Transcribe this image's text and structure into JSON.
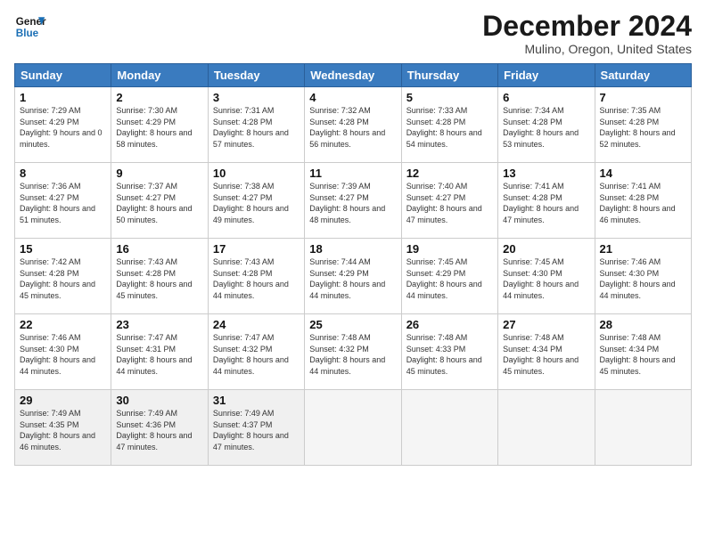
{
  "header": {
    "logo_text_general": "General",
    "logo_text_blue": "Blue",
    "month_title": "December 2024",
    "location": "Mulino, Oregon, United States"
  },
  "days_of_week": [
    "Sunday",
    "Monday",
    "Tuesday",
    "Wednesday",
    "Thursday",
    "Friday",
    "Saturday"
  ],
  "weeks": [
    [
      {
        "day": "1",
        "sunrise": "7:29 AM",
        "sunset": "4:29 PM",
        "daylight": "9 hours and 0 minutes."
      },
      {
        "day": "2",
        "sunrise": "7:30 AM",
        "sunset": "4:29 PM",
        "daylight": "8 hours and 58 minutes."
      },
      {
        "day": "3",
        "sunrise": "7:31 AM",
        "sunset": "4:28 PM",
        "daylight": "8 hours and 57 minutes."
      },
      {
        "day": "4",
        "sunrise": "7:32 AM",
        "sunset": "4:28 PM",
        "daylight": "8 hours and 56 minutes."
      },
      {
        "day": "5",
        "sunrise": "7:33 AM",
        "sunset": "4:28 PM",
        "daylight": "8 hours and 54 minutes."
      },
      {
        "day": "6",
        "sunrise": "7:34 AM",
        "sunset": "4:28 PM",
        "daylight": "8 hours and 53 minutes."
      },
      {
        "day": "7",
        "sunrise": "7:35 AM",
        "sunset": "4:28 PM",
        "daylight": "8 hours and 52 minutes."
      }
    ],
    [
      {
        "day": "8",
        "sunrise": "7:36 AM",
        "sunset": "4:27 PM",
        "daylight": "8 hours and 51 minutes."
      },
      {
        "day": "9",
        "sunrise": "7:37 AM",
        "sunset": "4:27 PM",
        "daylight": "8 hours and 50 minutes."
      },
      {
        "day": "10",
        "sunrise": "7:38 AM",
        "sunset": "4:27 PM",
        "daylight": "8 hours and 49 minutes."
      },
      {
        "day": "11",
        "sunrise": "7:39 AM",
        "sunset": "4:27 PM",
        "daylight": "8 hours and 48 minutes."
      },
      {
        "day": "12",
        "sunrise": "7:40 AM",
        "sunset": "4:27 PM",
        "daylight": "8 hours and 47 minutes."
      },
      {
        "day": "13",
        "sunrise": "7:41 AM",
        "sunset": "4:28 PM",
        "daylight": "8 hours and 47 minutes."
      },
      {
        "day": "14",
        "sunrise": "7:41 AM",
        "sunset": "4:28 PM",
        "daylight": "8 hours and 46 minutes."
      }
    ],
    [
      {
        "day": "15",
        "sunrise": "7:42 AM",
        "sunset": "4:28 PM",
        "daylight": "8 hours and 45 minutes."
      },
      {
        "day": "16",
        "sunrise": "7:43 AM",
        "sunset": "4:28 PM",
        "daylight": "8 hours and 45 minutes."
      },
      {
        "day": "17",
        "sunrise": "7:43 AM",
        "sunset": "4:28 PM",
        "daylight": "8 hours and 44 minutes."
      },
      {
        "day": "18",
        "sunrise": "7:44 AM",
        "sunset": "4:29 PM",
        "daylight": "8 hours and 44 minutes."
      },
      {
        "day": "19",
        "sunrise": "7:45 AM",
        "sunset": "4:29 PM",
        "daylight": "8 hours and 44 minutes."
      },
      {
        "day": "20",
        "sunrise": "7:45 AM",
        "sunset": "4:30 PM",
        "daylight": "8 hours and 44 minutes."
      },
      {
        "day": "21",
        "sunrise": "7:46 AM",
        "sunset": "4:30 PM",
        "daylight": "8 hours and 44 minutes."
      }
    ],
    [
      {
        "day": "22",
        "sunrise": "7:46 AM",
        "sunset": "4:30 PM",
        "daylight": "8 hours and 44 minutes."
      },
      {
        "day": "23",
        "sunrise": "7:47 AM",
        "sunset": "4:31 PM",
        "daylight": "8 hours and 44 minutes."
      },
      {
        "day": "24",
        "sunrise": "7:47 AM",
        "sunset": "4:32 PM",
        "daylight": "8 hours and 44 minutes."
      },
      {
        "day": "25",
        "sunrise": "7:48 AM",
        "sunset": "4:32 PM",
        "daylight": "8 hours and 44 minutes."
      },
      {
        "day": "26",
        "sunrise": "7:48 AM",
        "sunset": "4:33 PM",
        "daylight": "8 hours and 45 minutes."
      },
      {
        "day": "27",
        "sunrise": "7:48 AM",
        "sunset": "4:34 PM",
        "daylight": "8 hours and 45 minutes."
      },
      {
        "day": "28",
        "sunrise": "7:48 AM",
        "sunset": "4:34 PM",
        "daylight": "8 hours and 45 minutes."
      }
    ],
    [
      {
        "day": "29",
        "sunrise": "7:49 AM",
        "sunset": "4:35 PM",
        "daylight": "8 hours and 46 minutes."
      },
      {
        "day": "30",
        "sunrise": "7:49 AM",
        "sunset": "4:36 PM",
        "daylight": "8 hours and 47 minutes."
      },
      {
        "day": "31",
        "sunrise": "7:49 AM",
        "sunset": "4:37 PM",
        "daylight": "8 hours and 47 minutes."
      },
      null,
      null,
      null,
      null
    ]
  ]
}
